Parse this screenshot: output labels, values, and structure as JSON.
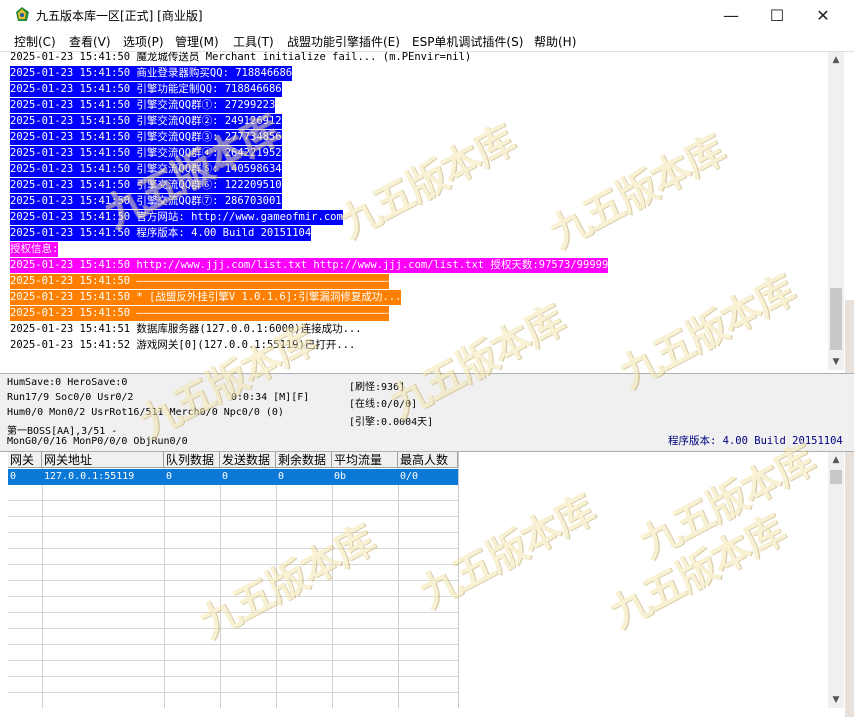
{
  "window": {
    "title": "九五版本库一区[正式] [商业版]",
    "minimize_glyph": "—",
    "maximize_glyph": "☐",
    "close_glyph": "✕"
  },
  "menu": [
    "控制(C)",
    "查看(V)",
    "选项(P)",
    "管理(M)",
    "工具(T)",
    "战盟功能引擎插件(E)",
    "ESP单机调试插件(S)",
    "帮助(H)"
  ],
  "log": [
    {
      "text": "2025-01-23 15:41:50 魔龙城传送员 Merchant initialize fail... (m.PEnvir=nil)",
      "bg": "#ffffff",
      "fg": "#000000"
    },
    {
      "text": "2025-01-23 15:41:50 商业登录器购买QQ: 718846686",
      "bg": "#0000ff",
      "fg": "#ffffff"
    },
    {
      "text": "2025-01-23 15:41:50 引擎功能定制QQ: 718846686",
      "bg": "#0000ff",
      "fg": "#ffffff"
    },
    {
      "text": "2025-01-23 15:41:50 引擎交流QQ群①: 27299223",
      "bg": "#0000ff",
      "fg": "#ffffff"
    },
    {
      "text": "2025-01-23 15:41:50 引擎交流QQ群②: 249126912",
      "bg": "#0000ff",
      "fg": "#ffffff"
    },
    {
      "text": "2025-01-23 15:41:50 引擎交流QQ群③: 277734856",
      "bg": "#0000ff",
      "fg": "#ffffff"
    },
    {
      "text": "2025-01-23 15:41:50 引擎交流QQ群④: 264221952",
      "bg": "#0000ff",
      "fg": "#ffffff"
    },
    {
      "text": "2025-01-23 15:41:50 引擎交流QQ群⑤: 140598634",
      "bg": "#0000ff",
      "fg": "#ffffff"
    },
    {
      "text": "2025-01-23 15:41:50 引擎交流QQ群⑥: 122209510",
      "bg": "#0000ff",
      "fg": "#ffffff"
    },
    {
      "text": "2025-01-23 15:41:50 引擎交流QQ群⑦: 286703001",
      "bg": "#0000ff",
      "fg": "#ffffff"
    },
    {
      "text": "2025-01-23 15:41:50 官方网站: http://www.gameofmir.com",
      "bg": "#0000ff",
      "fg": "#ffffff"
    },
    {
      "text": "2025-01-23 15:41:50 程序版本: 4.00 Build 20151104",
      "bg": "#0000ff",
      "fg": "#ffffff"
    },
    {
      "text": "授权信息:",
      "bg": "#ff00ff",
      "fg": "#ffffff"
    },
    {
      "text": "2025-01-23 15:41:50 http://www.jjj.com/list.txt http://www.jjj.com/list.txt 授权天数:97573/99999",
      "bg": "#ff00ff",
      "fg": "#ffffff"
    },
    {
      "text": "2025-01-23 15:41:50 ————————————————————————————————————————",
      "bg": "#ff8000",
      "fg": "#ffffff"
    },
    {
      "text": "2025-01-23 15:41:50 * [战盟反外挂引擎V 1.0.1.6]:引擎漏洞修复成功...",
      "bg": "#ff8000",
      "fg": "#ffffff"
    },
    {
      "text": "2025-01-23 15:41:50 ————————————————————————————————————————",
      "bg": "#ff8000",
      "fg": "#ffffff"
    },
    {
      "text": "2025-01-23 15:41:51 数据库服务器(127.0.0.1:6000)连接成功...",
      "bg": "#ffffff",
      "fg": "#000000"
    },
    {
      "text": "2025-01-23 15:41:52 游戏网关[0](127.0.0.1:55119)已打开...",
      "bg": "#ffffff",
      "fg": "#000000"
    }
  ],
  "status": {
    "line1": "HumSave:0 HeroSave:0",
    "line2": "Run17/9 Soc0/0 Usr0/2",
    "timer": "0:0:34 [M][F]",
    "line3": "Hum0/0 Mon0/2 UsrRot16/511 Merch0/0 Npc0/0 (0)",
    "line4": "第一BOSS[AA],3/51 -",
    "line5": "MonG0/0/16 MonP0/0/0 ObjRun0/0",
    "refresh": "[刷怪:936]",
    "online": "[在线:0/0/0]",
    "engine": "[引擎:0.0004天]",
    "version": "程序版本: 4.00 Build 20151104"
  },
  "grid": {
    "headers": [
      "网关",
      "网关地址",
      "队列数据",
      "发送数据",
      "剩余数据",
      "平均流量",
      "最高人数"
    ],
    "rows": [
      [
        "0",
        "127.0.0.1:55119",
        "0",
        "0",
        "0",
        "0b",
        "0/0"
      ]
    ]
  },
  "watermark": "九五版本库",
  "colors": {
    "blue_log": "#0000ff",
    "magenta_log": "#ff00ff",
    "orange_log": "#ff8000",
    "selection": "#0a78d7",
    "version_text": "#000080"
  }
}
